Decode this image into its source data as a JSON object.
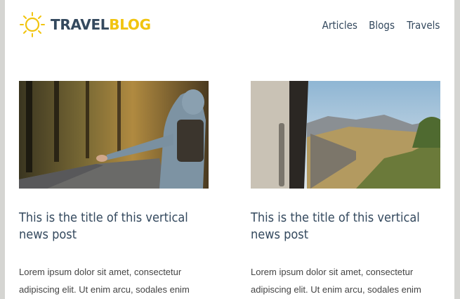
{
  "logo": {
    "part1": "TRAVEL",
    "part2": "BLOG",
    "accent_color": "#f1c40f",
    "text_color": "#34495e",
    "icon": "sun-icon"
  },
  "nav": {
    "items": [
      {
        "label": "Articles"
      },
      {
        "label": "Blogs"
      },
      {
        "label": "Travels"
      }
    ]
  },
  "posts": [
    {
      "image": "hitchhiker-forest-road-photo",
      "title": "This is the title of this vertical news post",
      "excerpt": "Lorem ipsum dolor sit amet, consectetur adipiscing elit. Ut enim arcu, sodales enim"
    },
    {
      "image": "train-mountains-photo",
      "title": "This is the title of this vertical news post",
      "excerpt": "Lorem ipsum dolor sit amet, consectetur adipiscing elit. Ut enim arcu, sodales enim"
    }
  ]
}
